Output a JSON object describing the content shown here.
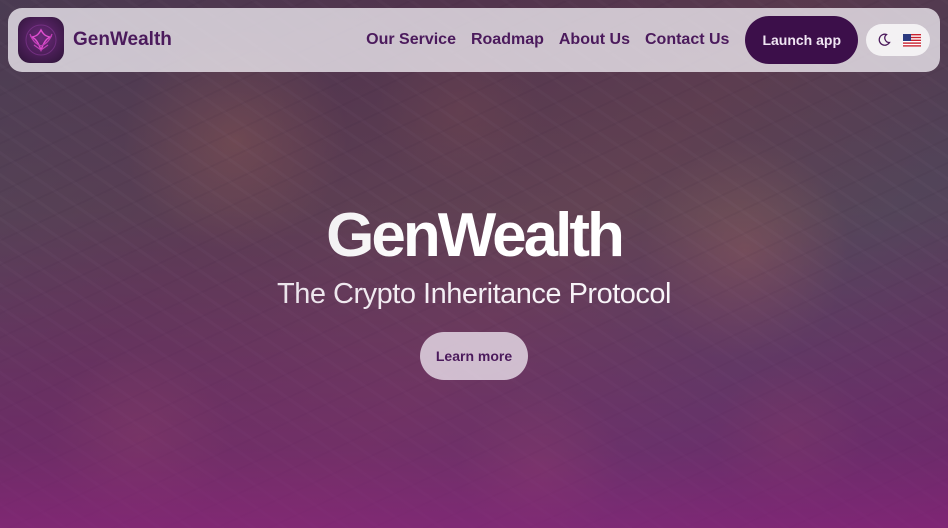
{
  "nav": {
    "brand": "GenWealth",
    "links": [
      "Our Service",
      "Roadmap",
      "About Us",
      "Contact Us"
    ],
    "launch_label": "Launch app",
    "theme_icon": "moon-icon",
    "language_icon": "us-flag-icon"
  },
  "hero": {
    "title": "GenWealth",
    "subtitle": "The Crypto Inheritance Protocol",
    "cta_label": "Learn more"
  },
  "colors": {
    "brand_purple": "#4b1a5c",
    "button_dark": "#3c0f4a",
    "overlay_purple": "#6e1a6e"
  }
}
